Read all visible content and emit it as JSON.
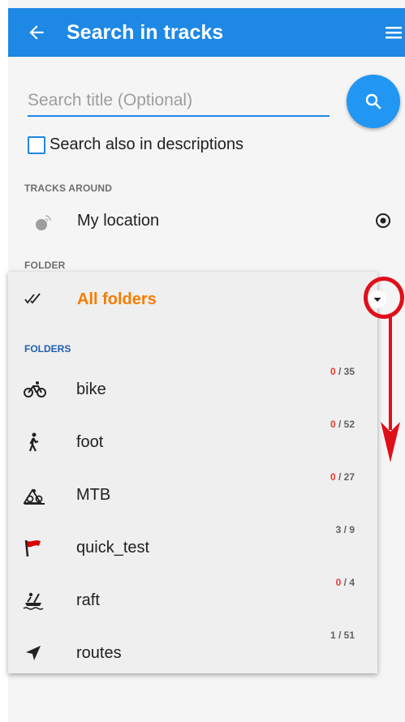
{
  "appbar": {
    "title": "Search in tracks",
    "back_icon": "arrow-left-icon",
    "menu_icon": "hamburger-menu-icon"
  },
  "search": {
    "placeholder": "Search title (Optional)",
    "value": "",
    "button_icon": "search-icon"
  },
  "checkbox": {
    "label": "Search also in descriptions",
    "checked": false
  },
  "tracks_around": {
    "header": "TRACKS AROUND",
    "location_label": "My location",
    "location_icon": "gps-signal-icon",
    "action_icon": "target-icon"
  },
  "folder": {
    "header": "FOLDER",
    "selected_label": "All folders",
    "selected_color": "#f57c00"
  },
  "folders": {
    "header": "FOLDERS",
    "items": [
      {
        "name": "bike",
        "shown": "0",
        "total": "35",
        "icon": "bicycle-icon"
      },
      {
        "name": "foot",
        "shown": "0",
        "total": "52",
        "icon": "walker-icon"
      },
      {
        "name": "MTB",
        "shown": "0",
        "total": "27",
        "icon": "mountain-bike-icon"
      },
      {
        "name": "quick_test",
        "shown": "3",
        "total": "9",
        "icon": "flag-icon"
      },
      {
        "name": "raft",
        "shown": "0",
        "total": "4",
        "icon": "raft-icon"
      },
      {
        "name": "routes",
        "shown": "1",
        "total": "51",
        "icon": "navigation-arrow-icon"
      }
    ]
  },
  "colors": {
    "appbar": "#1e88e5",
    "accent": "#2196f3",
    "highlight": "#e0101a"
  }
}
